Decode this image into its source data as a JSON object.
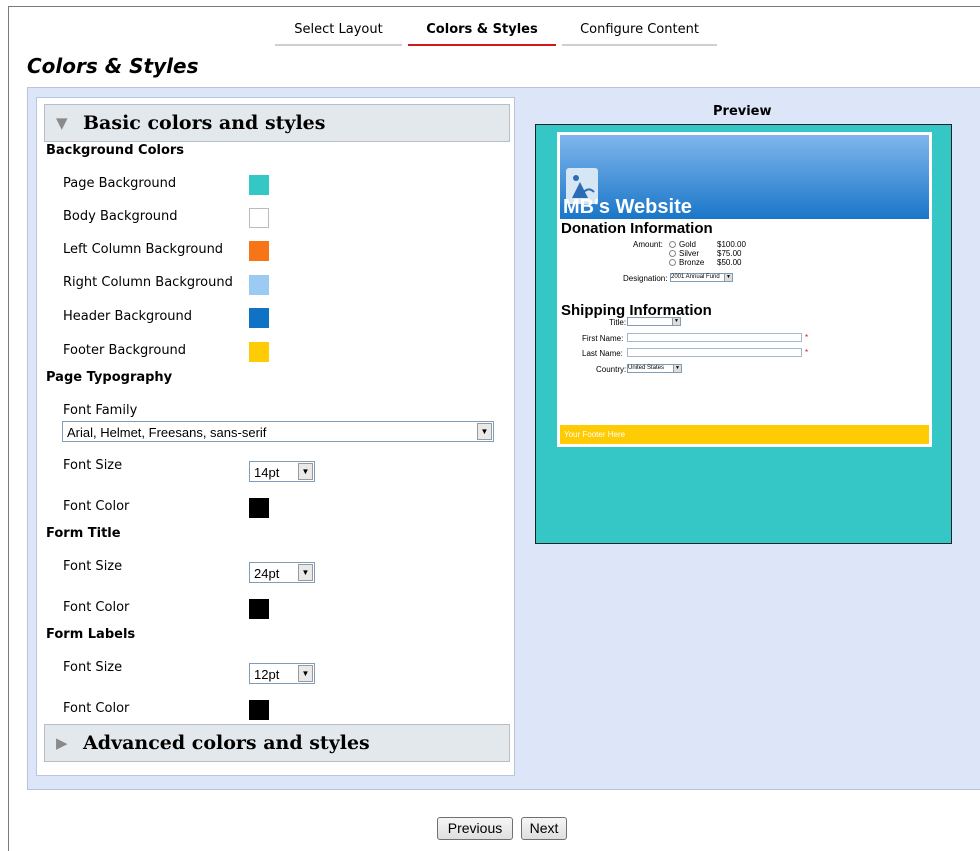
{
  "tabs": [
    {
      "label": "Select Layout"
    },
    {
      "label": "Colors & Styles"
    },
    {
      "label": "Configure Content"
    }
  ],
  "page_title": "Colors & Styles",
  "basic_section": {
    "title": "Basic colors and styles",
    "background_colors": {
      "title": "Background Colors",
      "items": [
        {
          "label": "Page Background",
          "color": "#34c7c6"
        },
        {
          "label": "Body Background",
          "color": "#ffffff"
        },
        {
          "label": "Left Column Background",
          "color": "#f77417"
        },
        {
          "label": "Right Column Background",
          "color": "#9bcaf2"
        },
        {
          "label": "Header Background",
          "color": "#0f72c4"
        },
        {
          "label": "Footer Background",
          "color": "#ffcb05"
        }
      ]
    },
    "page_typography": {
      "title": "Page Typography",
      "font_family_label": "Font Family",
      "font_family_value": "Arial, Helmet, Freesans, sans-serif",
      "font_size_label": "Font Size",
      "font_size_value": "14pt",
      "font_color_label": "Font Color",
      "font_color": "#000000"
    },
    "form_title": {
      "title": "Form Title",
      "font_size_label": "Font Size",
      "font_size_value": "24pt",
      "font_color_label": "Font Color",
      "font_color": "#000000"
    },
    "form_labels": {
      "title": "Form Labels",
      "font_size_label": "Font Size",
      "font_size_value": "12pt",
      "font_color_label": "Font Color",
      "font_color": "#000000"
    }
  },
  "advanced_section": {
    "title": "Advanced colors and styles"
  },
  "preview": {
    "label": "Preview",
    "site_title": "MB's Website",
    "donation_heading": "Donation Information",
    "amount_label": "Amount:",
    "amount_options": [
      {
        "name": "Gold",
        "price": "$100.00"
      },
      {
        "name": "Silver",
        "price": "$75.00"
      },
      {
        "name": "Bronze",
        "price": "$50.00"
      }
    ],
    "designation_label": "Designation:",
    "designation_value": "2001 Annual Fund",
    "shipping_heading": "Shipping Information",
    "title_label": "Title:",
    "first_name_label": "First Name:",
    "last_name_label": "Last Name:",
    "required_mark": "*",
    "country_label": "Country:",
    "country_value": "United States",
    "footer_text": "Your Footer Here"
  },
  "buttons": {
    "previous": "Previous",
    "next": "Next"
  }
}
